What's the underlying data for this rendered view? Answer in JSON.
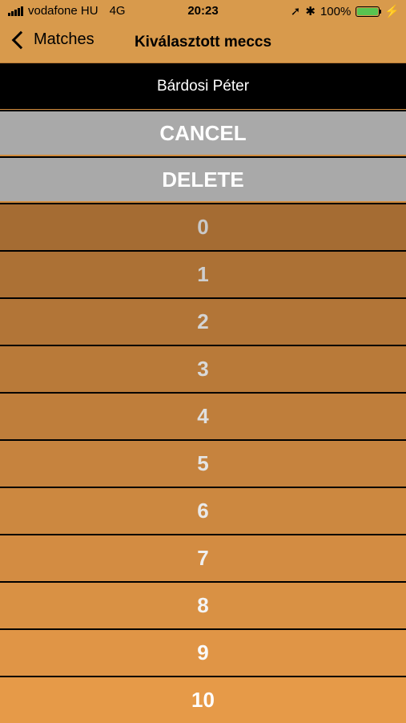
{
  "status": {
    "carrier": "vodafone HU",
    "network": "4G",
    "time": "20:23",
    "battery": "100%",
    "battery_level": 1.0
  },
  "nav": {
    "back_label": "Matches",
    "title": "Kiválasztott meccs"
  },
  "player_name": "Bárdosi Péter",
  "actions": {
    "cancel": "CANCEL",
    "delete": "DELETE"
  },
  "numbers": [
    "0",
    "1",
    "2",
    "3",
    "4",
    "5",
    "6",
    "7",
    "8",
    "9",
    "10"
  ],
  "colors": {
    "row_gradient_start": "#a56c33",
    "row_gradient_end": "#e69a48",
    "text_start": "#c9c9c9",
    "text_end": "#ffffff"
  }
}
